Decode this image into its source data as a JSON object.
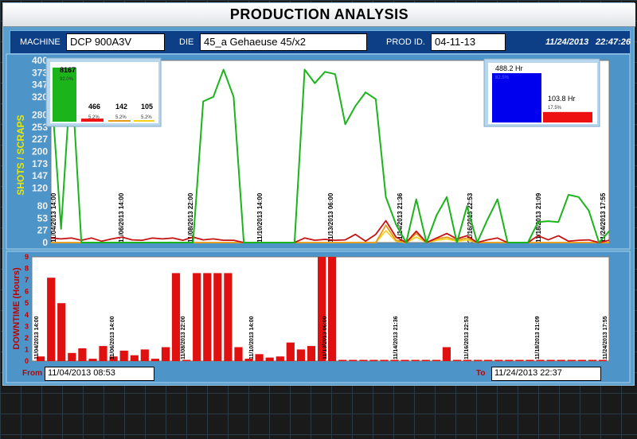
{
  "title": "PRODUCTION ANALYSIS",
  "header": {
    "machine_label": "MACHINE",
    "machine_value": "DCP 900A3V",
    "die_label": "DIE",
    "die_value": "45_a Gehaeuse 45/x2",
    "prod_label": "PROD ID.",
    "prod_value": "04-11-13",
    "date": "11/24/2013",
    "time": "22:47:26"
  },
  "footer": {
    "from_label": "From",
    "from_value": "11/04/2013 08:53",
    "to_label": "To",
    "to_value": "11/24/2013 22:37"
  },
  "colors": {
    "shots": "#1bb51b",
    "scrap1": "#c81414",
    "scrap2": "#e89a20",
    "scrap3": "#f2d21e",
    "downtime": "#e01010",
    "inset_run": "#0000ee",
    "inset_down": "#ee1111"
  },
  "chart_data": [
    {
      "type": "line",
      "ylabel": "SHOTS / SCRAPS",
      "ylim": [
        0,
        400
      ],
      "yticks": [
        0,
        27,
        53,
        80,
        120,
        147,
        173,
        200,
        227,
        253,
        280,
        320,
        347,
        373,
        400
      ],
      "grid": false,
      "x": [
        0,
        1,
        2,
        3,
        4,
        5,
        6,
        7,
        8,
        9,
        10,
        11,
        12,
        13,
        14,
        15,
        16,
        17,
        18,
        19,
        20,
        21,
        22,
        23,
        24,
        25,
        26,
        27,
        28,
        29,
        30,
        31,
        32,
        33,
        34,
        35,
        36,
        37,
        38,
        39,
        40,
        41,
        42,
        43,
        44,
        45,
        46,
        47,
        48,
        49,
        50,
        51,
        52,
        53,
        54,
        55
      ],
      "series": [
        {
          "values": [
            350,
            30,
            380,
            0,
            0,
            0,
            0,
            0,
            0,
            0,
            0,
            0,
            0,
            0,
            0,
            310,
            320,
            380,
            320,
            0,
            0,
            0,
            0,
            0,
            0,
            380,
            350,
            375,
            370,
            260,
            300,
            330,
            315,
            100,
            40,
            0,
            95,
            0,
            60,
            100,
            0,
            80,
            0,
            50,
            95,
            0,
            0,
            0,
            45,
            47,
            45,
            105,
            100,
            70,
            0,
            25
          ]
        },
        {
          "values": [
            10,
            8,
            10,
            5,
            10,
            3,
            8,
            12,
            6,
            5,
            10,
            8,
            10,
            5,
            12,
            6,
            8,
            5,
            5,
            0,
            0,
            0,
            0,
            0,
            0,
            10,
            5,
            7,
            5,
            6,
            18,
            3,
            18,
            48,
            12,
            0,
            25,
            0,
            10,
            20,
            8,
            15,
            0,
            6,
            10,
            0,
            0,
            0,
            15,
            6,
            15,
            3,
            5,
            6,
            0,
            5
          ]
        },
        {
          "values": [
            0,
            0,
            0,
            0,
            0,
            0,
            0,
            0,
            0,
            0,
            0,
            0,
            0,
            0,
            0,
            0,
            0,
            0,
            0,
            0,
            0,
            0,
            0,
            0,
            0,
            0,
            0,
            0,
            0,
            0,
            0,
            0,
            0,
            38,
            5,
            0,
            20,
            0,
            8,
            12,
            5,
            10,
            0,
            0,
            0,
            0,
            0,
            0,
            0,
            0,
            0,
            0,
            0,
            0,
            0,
            0
          ]
        },
        {
          "values": [
            0,
            0,
            0,
            0,
            0,
            0,
            0,
            0,
            0,
            0,
            0,
            0,
            0,
            0,
            0,
            0,
            0,
            0,
            0,
            0,
            0,
            0,
            0,
            0,
            0,
            0,
            0,
            0,
            0,
            0,
            0,
            0,
            0,
            26,
            3,
            0,
            12,
            0,
            5,
            8,
            3,
            6,
            0,
            0,
            0,
            0,
            0,
            0,
            0,
            0,
            0,
            0,
            0,
            0,
            0,
            0
          ]
        }
      ],
      "annotations": [
        "11/04/2013 14:00",
        "11/06/2013 14:00",
        "11/08/2013 22:00",
        "11/10/2013 14:00",
        "11/13/2013 06:00",
        "11/14/2013 21:36",
        "11/16/2013 22:53",
        "11/18/2013 21:09",
        "11/24/2013 17:55"
      ],
      "inset": {
        "type": "bar",
        "values": [
          8167,
          466,
          142,
          105
        ],
        "labels": [
          "8167",
          "466",
          "142",
          "105"
        ],
        "percents": [
          "92.0%",
          "5.2%",
          "5.2%",
          "5.2%"
        ]
      },
      "inset2": {
        "type": "bar",
        "values": [
          488.2,
          103.8
        ],
        "labels": [
          "488.2 Hr",
          "103.8 Hr"
        ],
        "percents": [
          "82.5%",
          "17.5%"
        ]
      }
    },
    {
      "type": "bar",
      "ylabel": "DOWNTIME (Hours)",
      "ylim": [
        0,
        9
      ],
      "yticks": [
        0,
        1,
        2,
        3,
        4,
        5,
        6,
        7,
        8,
        9
      ],
      "grid": false,
      "values": [
        0.4,
        7.2,
        5.0,
        0.7,
        1.1,
        0.2,
        1.3,
        0.4,
        0.9,
        0.5,
        1.0,
        0.2,
        1.2,
        7.6,
        0.1,
        7.6,
        7.6,
        7.6,
        7.6,
        1.2,
        0.2,
        0.6,
        0.3,
        0.4,
        1.6,
        1.0,
        1.3,
        9.0,
        9.0,
        0.1,
        0.1,
        0.1,
        0.1,
        0.1,
        0.1,
        0.1,
        0.1,
        0.1,
        0.1,
        1.2,
        0.1,
        0.1,
        0.1,
        0.1,
        0.1,
        0.1,
        0.1,
        0.1,
        0.1,
        0.1,
        0.1,
        0.1,
        0.1,
        0.1,
        0.1
      ],
      "annotations": [
        "11/04/2013 14:00",
        "11/06/2013 14:00",
        "11/08/2013 22:00",
        "11/10/2013 14:00",
        "11/13/2013 06:00",
        "11/14/2013 21:36",
        "11/16/2013 22:53",
        "11/18/2013 21:09",
        "11/24/2013 17:55"
      ]
    }
  ]
}
